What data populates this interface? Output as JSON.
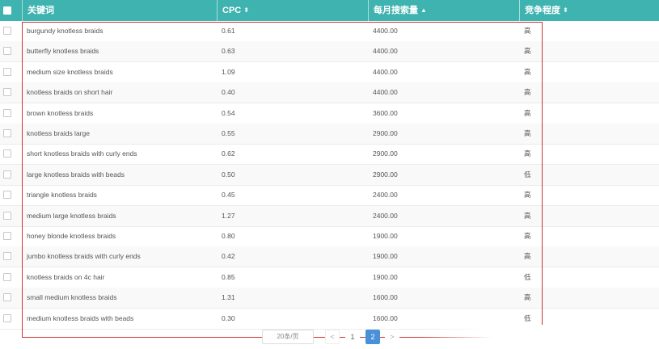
{
  "header": {
    "keyword": "关键词",
    "cpc": "CPC",
    "volume": "每月搜索量",
    "competition": "竞争程度",
    "sort_icon": "sort-icon"
  },
  "rows": [
    {
      "keyword": "burgundy knotless braids",
      "cpc": "0.61",
      "volume": "4400.00",
      "competition": "高"
    },
    {
      "keyword": "butterfly knotless braids",
      "cpc": "0.63",
      "volume": "4400.00",
      "competition": "高"
    },
    {
      "keyword": "medium size knotless braids",
      "cpc": "1.09",
      "volume": "4400.00",
      "competition": "高"
    },
    {
      "keyword": "knotless braids on short hair",
      "cpc": "0.40",
      "volume": "4400.00",
      "competition": "高"
    },
    {
      "keyword": "brown knotless braids",
      "cpc": "0.54",
      "volume": "3600.00",
      "competition": "高"
    },
    {
      "keyword": "knotless braids large",
      "cpc": "0.55",
      "volume": "2900.00",
      "competition": "高"
    },
    {
      "keyword": "short knotless braids with curly ends",
      "cpc": "0.62",
      "volume": "2900.00",
      "competition": "高"
    },
    {
      "keyword": "large knotless braids with beads",
      "cpc": "0.50",
      "volume": "2900.00",
      "competition": "低"
    },
    {
      "keyword": "triangle knotless braids",
      "cpc": "0.45",
      "volume": "2400.00",
      "competition": "高"
    },
    {
      "keyword": "medium large knotless braids",
      "cpc": "1.27",
      "volume": "2400.00",
      "competition": "高"
    },
    {
      "keyword": "honey blonde knotless braids",
      "cpc": "0.80",
      "volume": "1900.00",
      "competition": "高"
    },
    {
      "keyword": "jumbo knotless braids with curly ends",
      "cpc": "0.42",
      "volume": "1900.00",
      "competition": "高"
    },
    {
      "keyword": "knotless braids on 4c hair",
      "cpc": "0.85",
      "volume": "1900.00",
      "competition": "低"
    },
    {
      "keyword": "small medium knotless braids",
      "cpc": "1.31",
      "volume": "1600.00",
      "competition": "高"
    },
    {
      "keyword": "medium knotless braids with beads",
      "cpc": "0.30",
      "volume": "1600.00",
      "competition": "低"
    }
  ],
  "pagination": {
    "page_size": "20条/页",
    "prev": "<",
    "page_1": "1",
    "page_2": "2",
    "next": ">"
  },
  "colors": {
    "header_bg": "#3fb3b0",
    "highlight_border": "#cc3333",
    "active_page": "#4a90d9"
  }
}
